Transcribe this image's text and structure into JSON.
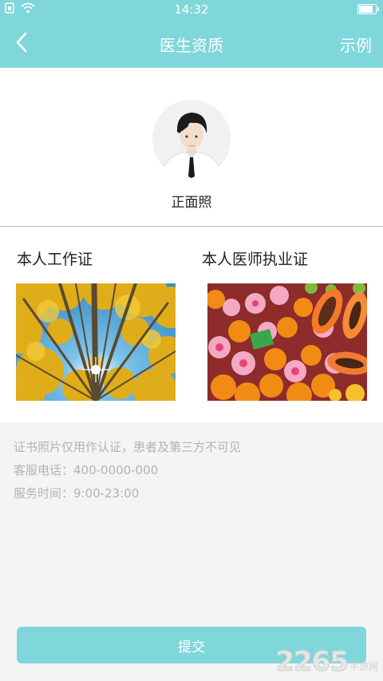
{
  "status_bar": {
    "time": "14:32",
    "icons": [
      "sim-icon",
      "wifi-icon",
      "battery-icon"
    ]
  },
  "nav": {
    "back_icon": "chevron-left-icon",
    "title": "医生资质",
    "example_label": "示例"
  },
  "profile": {
    "avatar_label": "正面照"
  },
  "certificates": {
    "work_id_title": "本人工作证",
    "license_title": "本人医师执业证"
  },
  "info": {
    "line1": "证书照片仅用作认证，患者及第三方不可见",
    "line2": "客服电话：400-0000-000",
    "line3": "服务时间：9:00-23:00"
  },
  "submit": {
    "label": "提交"
  },
  "watermark": {
    "number": "2265",
    "suffix": "手游网"
  },
  "colors": {
    "accent": "#7fd7dc",
    "background": "#f4f4f4",
    "info_text": "#b3b3b3"
  }
}
